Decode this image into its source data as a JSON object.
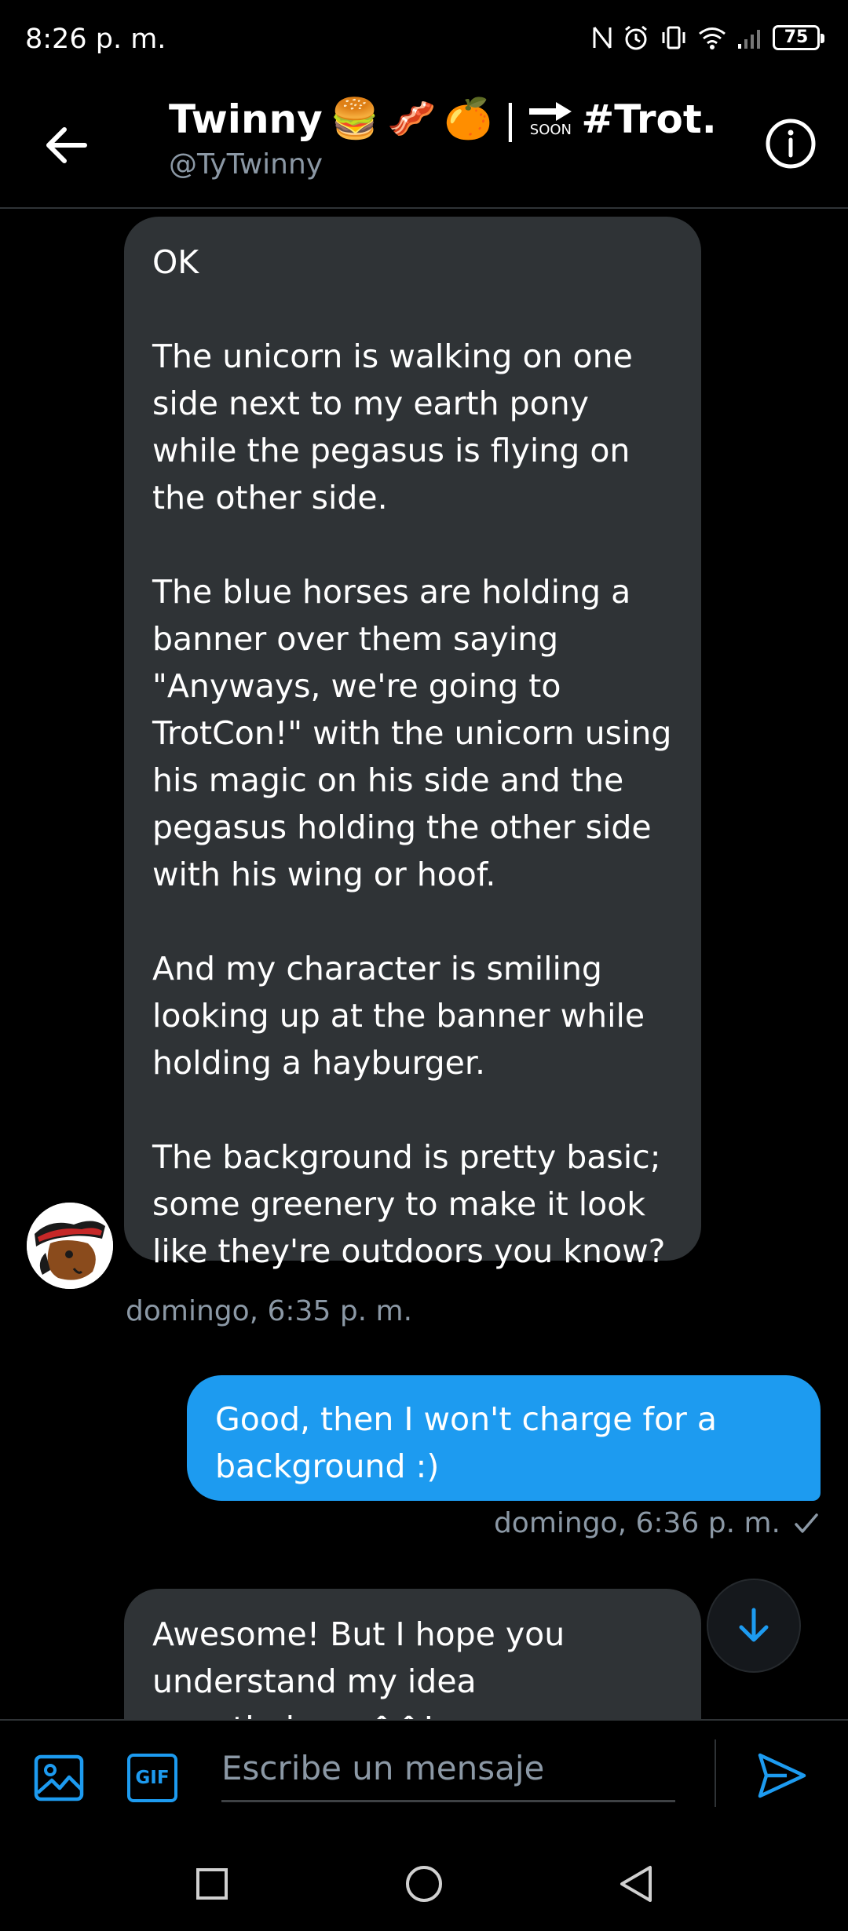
{
  "status_bar": {
    "time": "8:26 p. m.",
    "battery": "75"
  },
  "header": {
    "title_name": "Twinny",
    "title_emoji_1": "🍔",
    "title_emoji_2": "🥓",
    "title_emoji_3": "🍊",
    "title_separator": "|",
    "title_soon_label": "SOON",
    "title_hashtag": "#Trot...",
    "handle": "@TyTwinny"
  },
  "messages": [
    {
      "direction": "incoming",
      "text": "OK\n\nThe unicorn is walking on one side next to my earth pony while the pegasus is flying on the other side.\n\nThe blue horses are holding a banner over them saying \"Anyways, we're going to TrotCon!\" with the unicorn using his magic on his side and the pegasus holding the other side with his wing or hoof.\n\nAnd my character is smiling looking up at the banner while holding a hayburger.\n\nThe background is pretty basic; some greenery to make it look like they're outdoors you know?",
      "timestamp": "domingo, 6:35 p. m."
    },
    {
      "direction": "outgoing",
      "text": "Good, then I won't charge for a background :)",
      "timestamp": "domingo, 6:36 p. m."
    },
    {
      "direction": "incoming",
      "text": "Awesome! But I hope you understand my idea nonetheless. ^^!"
    }
  ],
  "composer": {
    "gif_label": "GIF",
    "placeholder": "Escribe un mensaje"
  },
  "colors": {
    "accent": "#1d9bf0",
    "incoming_bubble": "#2f3336",
    "muted_text": "#8b98a5",
    "background": "#000000"
  },
  "icons": {
    "back": "arrow-left-icon",
    "info": "info-circle-icon",
    "media": "image-icon",
    "send": "send-icon",
    "scroll_down": "arrow-down-icon",
    "read_receipt": "checkmark-icon",
    "nav_recents": "square-icon",
    "nav_home": "circle-icon",
    "nav_back": "triangle-back-icon"
  }
}
